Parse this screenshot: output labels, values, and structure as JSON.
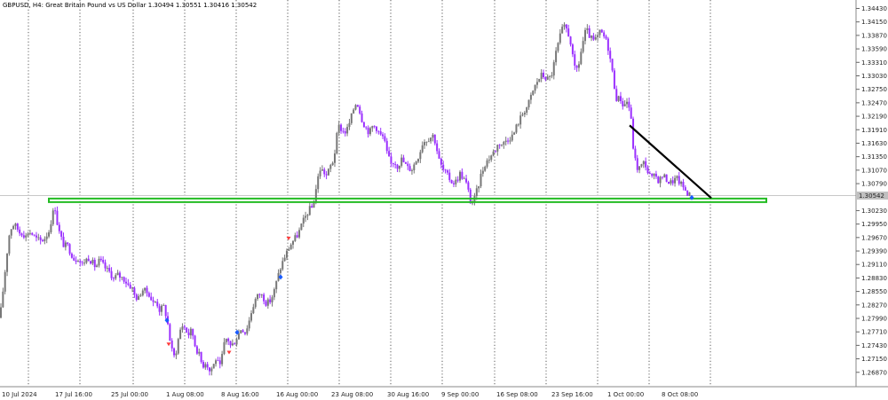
{
  "chart_data": {
    "type": "candlestick",
    "symbol": "GBPUSD",
    "timeframe": "H4",
    "description": "Great Britain Pound vs US Dollar",
    "ohlc_label": "1.30494 1.30551 1.30416 1.30542",
    "y_ticks": [
      1.3443,
      1.3415,
      1.3387,
      1.3359,
      1.3331,
      1.3303,
      1.3275,
      1.3247,
      1.3219,
      1.3191,
      1.3163,
      1.3135,
      1.3107,
      1.3079,
      1.3023,
      1.2995,
      1.2967,
      1.2939,
      1.2911,
      1.2883,
      1.2855,
      1.2827,
      1.2799,
      1.2771,
      1.2743,
      1.2715,
      1.2687
    ],
    "y_tick_labels": [
      "1.34430",
      "1.34150",
      "1.33870",
      "1.33590",
      "1.33310",
      "1.33030",
      "1.32750",
      "1.32470",
      "1.32190",
      "1.31910",
      "1.31630",
      "1.31350",
      "1.31070",
      "1.30790",
      "1.30230",
      "1.29950",
      "1.29670",
      "1.29390",
      "1.29110",
      "1.28830",
      "1.28550",
      "1.28270",
      "1.27990",
      "1.27710",
      "1.27430",
      "1.27150",
      "1.26870"
    ],
    "current_price": "1.30542",
    "ylim": [
      1.267,
      1.3455
    ],
    "x_labels": [
      "10 Jul 2024",
      "17 Jul 16:00",
      "25 Jul 00:00",
      "1 Aug 08:00",
      "8 Aug 16:00",
      "16 Aug 00:00",
      "23 Aug 08:00",
      "30 Aug 16:00",
      "9 Sep 00:00",
      "16 Sep 08:00",
      "23 Sep 16:00",
      "1 Oct 00:00",
      "8 Oct 08:00"
    ],
    "close_path": [
      [
        0,
        1.28
      ],
      [
        3,
        1.285
      ],
      [
        7,
        1.292
      ],
      [
        10,
        1.297
      ],
      [
        14,
        1.2995
      ],
      [
        18,
        1.299
      ],
      [
        23,
        1.2975
      ],
      [
        26,
        1.298
      ],
      [
        28,
        1.2965
      ],
      [
        32,
        1.298
      ],
      [
        36,
        1.2975
      ],
      [
        40,
        1.2965
      ],
      [
        46,
        1.296
      ],
      [
        50,
        1.2965
      ],
      [
        55,
        1.298
      ],
      [
        59,
        1.3015
      ],
      [
        62,
        1.303
      ],
      [
        65,
        1.299
      ],
      [
        68,
        1.297
      ],
      [
        72,
        1.295
      ],
      [
        76,
        1.295
      ],
      [
        80,
        1.2935
      ],
      [
        84,
        1.292
      ],
      [
        88,
        1.2925
      ],
      [
        92,
        1.291
      ],
      [
        96,
        1.292
      ],
      [
        100,
        1.2925
      ],
      [
        104,
        1.2915
      ],
      [
        108,
        1.2905
      ],
      [
        112,
        1.292
      ],
      [
        116,
        1.291
      ],
      [
        120,
        1.29
      ],
      [
        124,
        1.2895
      ],
      [
        128,
        1.288
      ],
      [
        132,
        1.289
      ],
      [
        136,
        1.2885
      ],
      [
        140,
        1.288
      ],
      [
        144,
        1.287
      ],
      [
        148,
        1.2865
      ],
      [
        152,
        1.2845
      ],
      [
        156,
        1.284
      ],
      [
        160,
        1.286
      ],
      [
        164,
        1.2855
      ],
      [
        168,
        1.285
      ],
      [
        172,
        1.283
      ],
      [
        176,
        1.2835
      ],
      [
        180,
        1.2815
      ],
      [
        184,
        1.2825
      ],
      [
        188,
        1.28
      ],
      [
        191,
        1.276
      ],
      [
        193,
        1.2735
      ],
      [
        196,
        1.272
      ],
      [
        199,
        1.2735
      ],
      [
        202,
        1.277
      ],
      [
        205,
        1.2785
      ],
      [
        208,
        1.278
      ],
      [
        212,
        1.2765
      ],
      [
        216,
        1.2775
      ],
      [
        220,
        1.274
      ],
      [
        224,
        1.2725
      ],
      [
        228,
        1.27
      ],
      [
        232,
        1.271
      ],
      [
        236,
        1.269
      ],
      [
        240,
        1.27
      ],
      [
        244,
        1.272
      ],
      [
        247,
        1.269
      ],
      [
        250,
        1.272
      ],
      [
        253,
        1.275
      ],
      [
        256,
        1.276
      ],
      [
        260,
        1.274
      ],
      [
        264,
        1.275
      ],
      [
        268,
        1.2765
      ],
      [
        272,
        1.278
      ],
      [
        276,
        1.277
      ],
      [
        280,
        1.279
      ],
      [
        284,
        1.282
      ],
      [
        288,
        1.284
      ],
      [
        292,
        1.285
      ],
      [
        296,
        1.2845
      ],
      [
        300,
        1.283
      ],
      [
        304,
        1.2835
      ],
      [
        308,
        1.285
      ],
      [
        312,
        1.288
      ],
      [
        316,
        1.2905
      ],
      [
        320,
        1.2925
      ],
      [
        324,
        1.294
      ],
      [
        328,
        1.2955
      ],
      [
        332,
        1.2965
      ],
      [
        336,
        1.2975
      ],
      [
        340,
        1.2995
      ],
      [
        344,
        1.301
      ],
      [
        348,
        1.3025
      ],
      [
        352,
        1.303
      ],
      [
        356,
        1.307
      ],
      [
        360,
        1.311
      ],
      [
        364,
        1.3105
      ],
      [
        368,
        1.3095
      ],
      [
        372,
        1.3115
      ],
      [
        376,
        1.313
      ],
      [
        379,
        1.3175
      ],
      [
        382,
        1.32
      ],
      [
        385,
        1.319
      ],
      [
        388,
        1.3185
      ],
      [
        392,
        1.3195
      ],
      [
        396,
        1.322
      ],
      [
        399,
        1.324
      ],
      [
        402,
        1.325
      ],
      [
        405,
        1.323
      ],
      [
        408,
        1.321
      ],
      [
        412,
        1.3195
      ],
      [
        416,
        1.3185
      ],
      [
        420,
        1.32
      ],
      [
        424,
        1.3195
      ],
      [
        428,
        1.318
      ],
      [
        432,
        1.3175
      ],
      [
        436,
        1.314
      ],
      [
        440,
        1.312
      ],
      [
        444,
        1.3125
      ],
      [
        448,
        1.3115
      ],
      [
        452,
        1.313
      ],
      [
        456,
        1.312
      ],
      [
        460,
        1.311
      ],
      [
        464,
        1.311
      ],
      [
        468,
        1.3125
      ],
      [
        472,
        1.314
      ],
      [
        476,
        1.3165
      ],
      [
        480,
        1.317
      ],
      [
        484,
        1.3175
      ],
      [
        488,
        1.318
      ],
      [
        491,
        1.316
      ],
      [
        494,
        1.313
      ],
      [
        498,
        1.311
      ],
      [
        502,
        1.31
      ],
      [
        506,
        1.309
      ],
      [
        510,
        1.308
      ],
      [
        514,
        1.3085
      ],
      [
        518,
        1.31
      ],
      [
        522,
        1.309
      ],
      [
        526,
        1.3075
      ],
      [
        530,
        1.304
      ],
      [
        534,
        1.3045
      ],
      [
        538,
        1.307
      ],
      [
        542,
        1.31
      ],
      [
        546,
        1.312
      ],
      [
        550,
        1.313
      ],
      [
        554,
        1.314
      ],
      [
        558,
        1.315
      ],
      [
        562,
        1.3165
      ],
      [
        566,
        1.316
      ],
      [
        570,
        1.317
      ],
      [
        574,
        1.3175
      ],
      [
        578,
        1.318
      ],
      [
        582,
        1.32
      ],
      [
        586,
        1.3215
      ],
      [
        590,
        1.323
      ],
      [
        594,
        1.324
      ],
      [
        598,
        1.326
      ],
      [
        602,
        1.328
      ],
      [
        606,
        1.3295
      ],
      [
        610,
        1.3305
      ],
      [
        614,
        1.33
      ],
      [
        618,
        1.3295
      ],
      [
        622,
        1.331
      ],
      [
        626,
        1.335
      ],
      [
        630,
        1.338
      ],
      [
        634,
        1.3405
      ],
      [
        638,
        1.34
      ],
      [
        642,
        1.338
      ],
      [
        645,
        1.334
      ],
      [
        648,
        1.331
      ],
      [
        652,
        1.333
      ],
      [
        656,
        1.337
      ],
      [
        660,
        1.34
      ],
      [
        664,
        1.3385
      ],
      [
        668,
        1.3375
      ],
      [
        672,
        1.338
      ],
      [
        676,
        1.3395
      ],
      [
        680,
        1.3385
      ],
      [
        684,
        1.337
      ],
      [
        688,
        1.333
      ],
      [
        692,
        1.328
      ],
      [
        695,
        1.325
      ],
      [
        698,
        1.326
      ],
      [
        702,
        1.324
      ],
      [
        706,
        1.325
      ],
      [
        710,
        1.323
      ],
      [
        712,
        1.317
      ],
      [
        715,
        1.313
      ],
      [
        718,
        1.311
      ],
      [
        722,
        1.3115
      ],
      [
        726,
        1.3125
      ],
      [
        730,
        1.31
      ],
      [
        734,
        1.309
      ],
      [
        738,
        1.3095
      ],
      [
        742,
        1.3085
      ],
      [
        746,
        1.3095
      ],
      [
        750,
        1.309
      ],
      [
        754,
        1.308
      ],
      [
        758,
        1.3085
      ],
      [
        762,
        1.309
      ],
      [
        766,
        1.308
      ],
      [
        770,
        1.307
      ],
      [
        774,
        1.306
      ],
      [
        778,
        1.3054
      ]
    ],
    "support_zone": {
      "price_top": 1.3048,
      "price_bottom": 1.3041,
      "x_start_date": "17 Jul 16:00",
      "x_end_date": "after 8 Oct 08:00",
      "color": "#22bb22"
    },
    "trendline": {
      "start_price": 1.32,
      "end_price": 1.3049,
      "color": "#000000"
    },
    "markers": [
      {
        "x": 188,
        "price": 1.2795,
        "color": "#1a5cff",
        "shape": "diamond"
      },
      {
        "x": 190,
        "price": 1.2745,
        "color": "#ff3a3a",
        "shape": "arrow"
      },
      {
        "x": 258,
        "price": 1.2728,
        "color": "#ff3a3a",
        "shape": "arrow"
      },
      {
        "x": 267,
        "price": 1.277,
        "color": "#1a5cff",
        "shape": "diamond"
      },
      {
        "x": 325,
        "price": 1.2965,
        "color": "#ff3a3a",
        "shape": "arrow"
      },
      {
        "x": 316,
        "price": 1.2885,
        "color": "#1a5cff",
        "shape": "diamond"
      },
      {
        "x": 779,
        "price": 1.305,
        "color": "#1a5cff",
        "shape": "diamond"
      }
    ],
    "colors": {
      "bull": "#777777",
      "bear": "#9b30ff",
      "grid": "#333333",
      "price_line": "#c0c0c0"
    },
    "grid": "vertical dotted"
  }
}
